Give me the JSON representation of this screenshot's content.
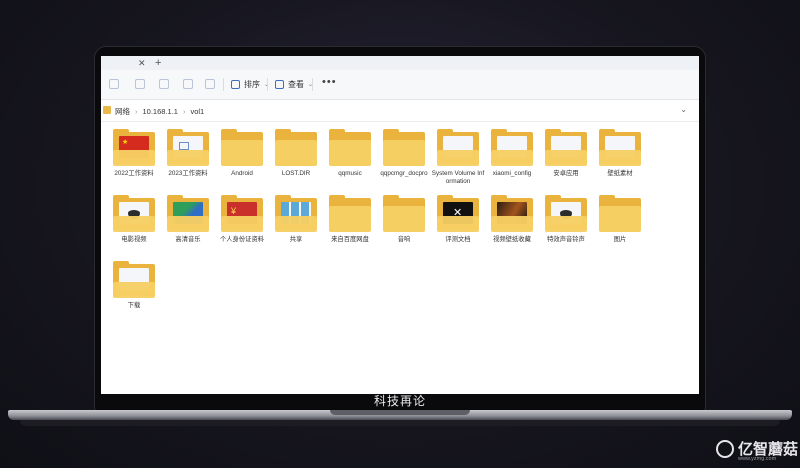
{
  "explorer": {
    "toolbar": {
      "sort_label": "排序",
      "view_label": "查看",
      "more_label": "•••"
    },
    "address": {
      "crumbs": [
        "网络",
        "10.168.1.1",
        "vol1"
      ]
    },
    "items": [
      {
        "label": "2022工作资料",
        "thumb": "china-flag"
      },
      {
        "label": "2023工作资料",
        "thumb": "image-doc"
      },
      {
        "label": "Android",
        "thumb": "none"
      },
      {
        "label": "LOST.DIR",
        "thumb": "none"
      },
      {
        "label": "qqmusic",
        "thumb": "none"
      },
      {
        "label": "qqpcmgr_docpro",
        "thumb": "none"
      },
      {
        "label": "System Volume Information",
        "thumb": "doc"
      },
      {
        "label": "xiaomi_config",
        "thumb": "doc"
      },
      {
        "label": "安卓应用",
        "thumb": "doc"
      },
      {
        "label": "壁纸素材",
        "thumb": "doc"
      },
      {
        "label": "电影视频",
        "thumb": "dark-circle"
      },
      {
        "label": "高清音乐",
        "thumb": "green-blue"
      },
      {
        "label": "个人身份证资料",
        "thumb": "red-id"
      },
      {
        "label": "共享",
        "thumb": "windows"
      },
      {
        "label": "来自百度网盘",
        "thumb": "none"
      },
      {
        "label": "音响",
        "thumb": "none"
      },
      {
        "label": "评测文档",
        "thumb": "black-x"
      },
      {
        "label": "视频壁纸收藏",
        "thumb": "dark-photo"
      },
      {
        "label": "特效声音铃声",
        "thumb": "dark-circle"
      },
      {
        "label": "图片",
        "thumb": "none"
      },
      {
        "label": "下载",
        "thumb": "doc"
      }
    ]
  },
  "caption": "科技再论",
  "watermark": {
    "name": "亿智蘑菇",
    "url": "www.yzmg.com"
  },
  "colors": {
    "folder_back": "#e9b33d",
    "folder_front": "#f6cf63",
    "accent": "#3f6fb8"
  }
}
